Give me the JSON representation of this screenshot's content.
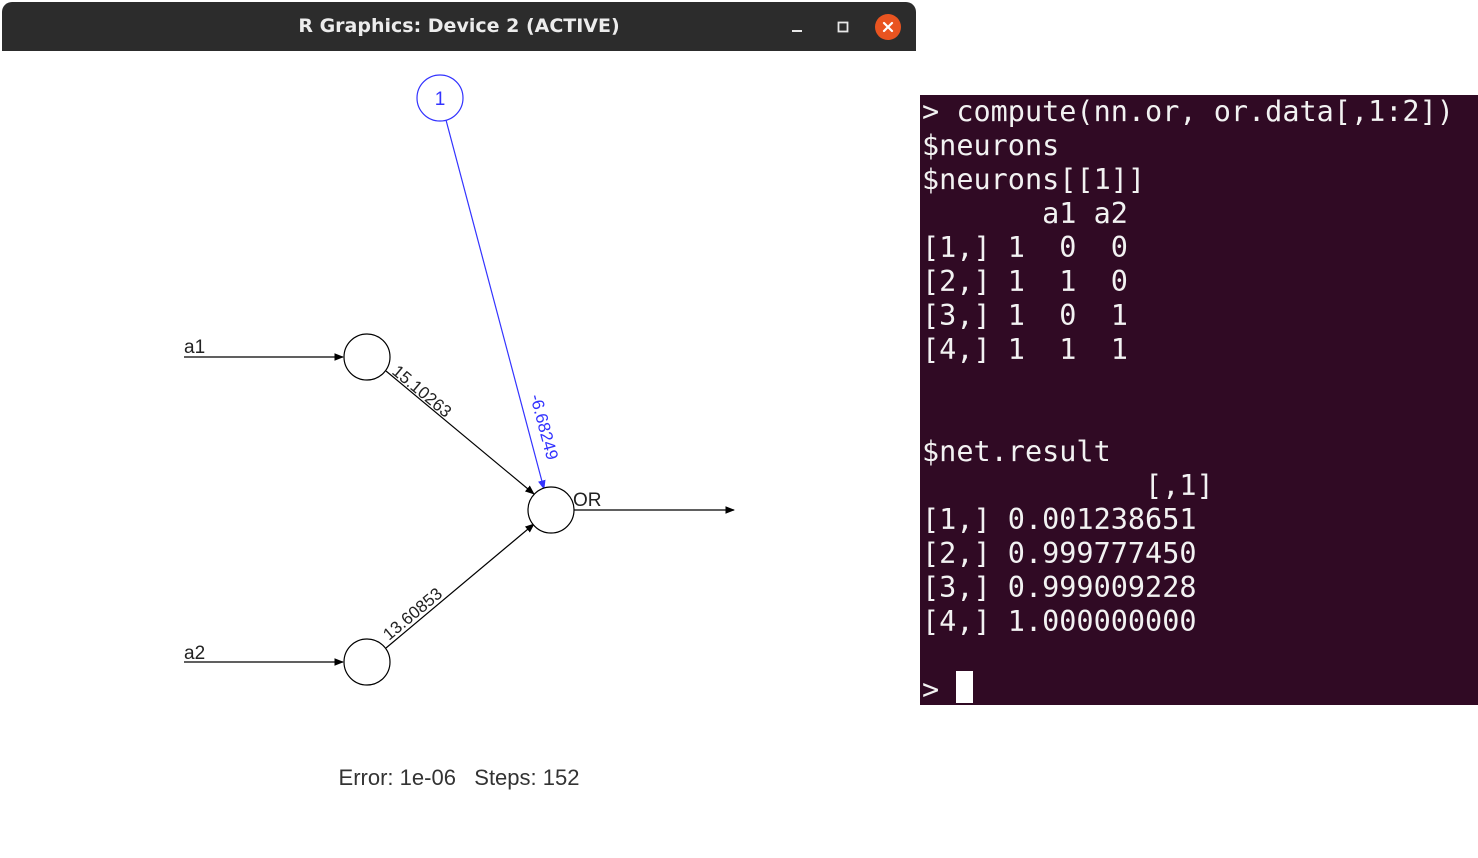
{
  "window": {
    "title": "R Graphics: Device 2 (ACTIVE)",
    "buttons": [
      "minimize-icon",
      "maximize-icon",
      "close-icon"
    ],
    "close_color": "#e95420"
  },
  "network": {
    "inputs": [
      "a1",
      "a2"
    ],
    "output": "OR",
    "bias_node": "1",
    "weights": {
      "a1_to_out": "15.10263",
      "a2_to_out": "13.60853",
      "bias_to_out": "-6.68249"
    },
    "footer": "Error: 1e-06   Steps: 152",
    "bias_color": "#3333ff"
  },
  "terminal": {
    "background": "#300a24",
    "lines": [
      "> compute(nn.or, or.data[,1:2])",
      "$neurons",
      "$neurons[[1]]",
      "       a1 a2",
      "[1,] 1  0  0",
      "[2,] 1  1  0",
      "[3,] 1  0  1",
      "[4,] 1  1  1",
      "",
      "",
      "$net.result",
      "             [,1]",
      "[1,] 0.001238651",
      "[2,] 0.999777450",
      "[3,] 0.999009228",
      "[4,] 1.000000000",
      "",
      ">"
    ]
  }
}
